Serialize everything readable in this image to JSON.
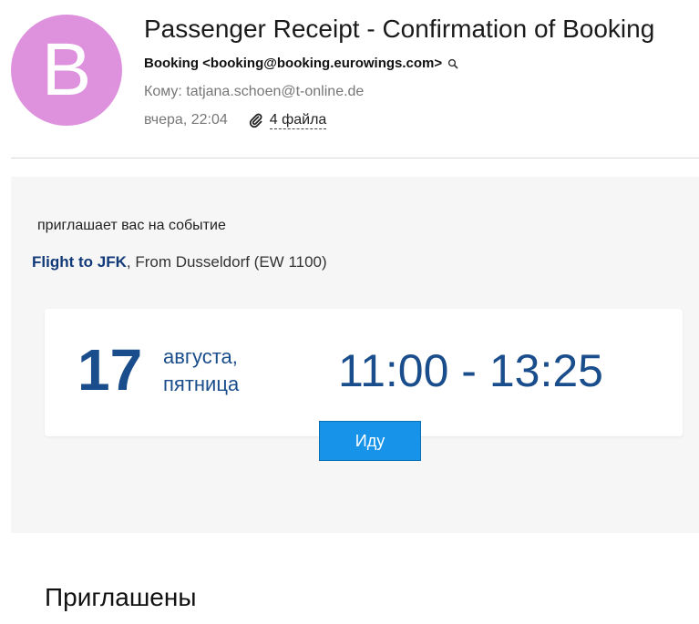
{
  "avatar": {
    "letter": "B",
    "color": "#de92de"
  },
  "message": {
    "subject": "Passenger Receipt - Confirmation of Booking",
    "from": "Booking <booking@booking.eurowings.com>",
    "to": "Кому: tatjana.schoen@t-online.de",
    "date": "вчера, 22:04",
    "attachments": "4 файла"
  },
  "invitation": {
    "intro": "приглашает вас на событие",
    "event_title": "Flight to JFK",
    "event_details": ", From Dusseldorf (EW 1100)",
    "day_number": "17",
    "month": "августа,",
    "weekday": "пятница",
    "time_range": "11:00 - 13:25",
    "go_label": "Иду"
  },
  "invited_section": {
    "heading": "Приглашены"
  },
  "icons": {
    "search": "magnifier-icon",
    "attachment": "paperclip-icon"
  },
  "colors": {
    "accent_blue": "#1a4d8b",
    "button_blue": "#1793ea",
    "event_title": "#123a78"
  }
}
